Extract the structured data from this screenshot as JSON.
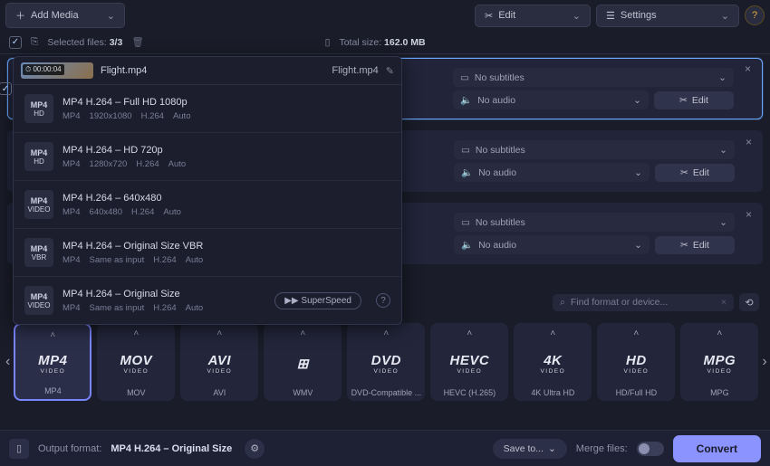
{
  "topbar": {
    "add_media": "Add Media",
    "edit": "Edit",
    "settings": "Settings",
    "help": "?"
  },
  "infobar": {
    "selected_label": "Selected files:",
    "selected_value": "3/3",
    "total_label": "Total size:",
    "total_value": "162.0 MB"
  },
  "preset_header": {
    "duration": "00:00:04",
    "filename_left": "Flight.mp4",
    "filename_right": "Flight.mp4"
  },
  "presets": [
    {
      "title": "MP4 H.264 – Full HD 1080p",
      "fmt": "MP4",
      "res": "1920x1080",
      "codec": "H.264",
      "mode": "Auto",
      "badge": "HD"
    },
    {
      "title": "MP4 H.264 – HD 720p",
      "fmt": "MP4",
      "res": "1280x720",
      "codec": "H.264",
      "mode": "Auto",
      "badge": "HD"
    },
    {
      "title": "MP4 H.264 – 640x480",
      "fmt": "MP4",
      "res": "640x480",
      "codec": "H.264",
      "mode": "Auto",
      "badge": ""
    },
    {
      "title": "MP4 H.264 – Original Size VBR",
      "fmt": "MP4",
      "res": "Same as input",
      "codec": "H.264",
      "mode": "Auto",
      "badge": "VBR"
    },
    {
      "title": "MP4 H.264 – Original Size",
      "fmt": "MP4",
      "res": "Same as input",
      "codec": "H.264",
      "mode": "Auto",
      "badge": "",
      "superspeed": true
    }
  ],
  "superspeed_label": "SuperSpeed",
  "row_controls": {
    "subtitles": "No subtitles",
    "audio": "No audio",
    "edit": "Edit"
  },
  "search": {
    "placeholder": "Find format or device..."
  },
  "formats": [
    {
      "logo": "MP4",
      "sub": "VIDEO",
      "label": "MP4",
      "selected": true
    },
    {
      "logo": "MOV",
      "sub": "VIDEO",
      "label": "MOV"
    },
    {
      "logo": "AVI",
      "sub": "VIDEO",
      "label": "AVI"
    },
    {
      "logo": "⊞",
      "sub": "",
      "label": "WMV"
    },
    {
      "logo": "DVD",
      "sub": "VIDEO",
      "label": "DVD-Compatible ..."
    },
    {
      "logo": "HEVC",
      "sub": "VIDEO",
      "label": "HEVC (H.265)"
    },
    {
      "logo": "4K",
      "sub": "VIDEO",
      "label": "4K Ultra HD"
    },
    {
      "logo": "HD",
      "sub": "VIDEO",
      "label": "HD/Full HD"
    },
    {
      "logo": "MPG",
      "sub": "VIDEO",
      "label": "MPG"
    }
  ],
  "bottombar": {
    "output_label": "Output format:",
    "output_value": "MP4 H.264 – Original Size",
    "save_to": "Save to...",
    "merge_label": "Merge files:",
    "convert": "Convert"
  }
}
